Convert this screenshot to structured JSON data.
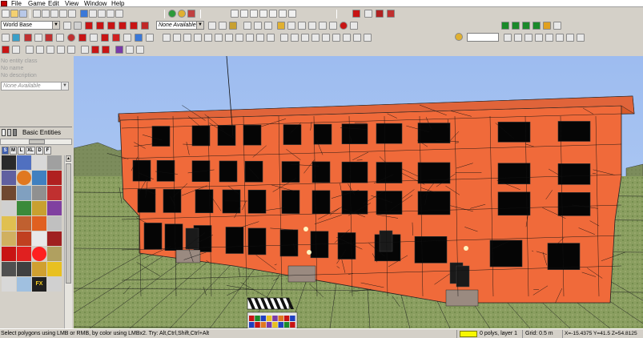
{
  "menu": {
    "items": [
      "File",
      "Game",
      "Edit",
      "View",
      "Window",
      "Help"
    ]
  },
  "toolbar": {
    "world_select": "World Base",
    "availability_select": "None Available",
    "snap_input": "",
    "colors": {
      "red": "#c81414",
      "green": "#1a8a2a",
      "blue": "#2040c0",
      "yellow": "#e8c020",
      "purple": "#7a3aa8",
      "orange": "#e07820"
    }
  },
  "left_panel": {
    "entity_class": "No entity class",
    "entity_name": "No name",
    "entity_description": "No description",
    "entity_dropdown": "None Available",
    "entity_list_title": "Basic Entities",
    "size_buttons": [
      "S",
      "M",
      "L",
      "XL",
      "D",
      "F"
    ]
  },
  "viewport": {
    "building_color": "#f06a3a",
    "sky_color": "#a7c3f2",
    "grass_color": "#8a9e60"
  },
  "status": {
    "hint": "Select polygons using LMB or RMB, by color using LMBx2. Try: Alt,Ctrl,Shift,Ctrl+Alt",
    "layer_swatch": "#f8f800",
    "polys_layer": "0 polys, layer 1",
    "grid": "Grid: 0.5 m",
    "coords": "X=-15.4375 Y=41.5 Z=54.8125"
  }
}
